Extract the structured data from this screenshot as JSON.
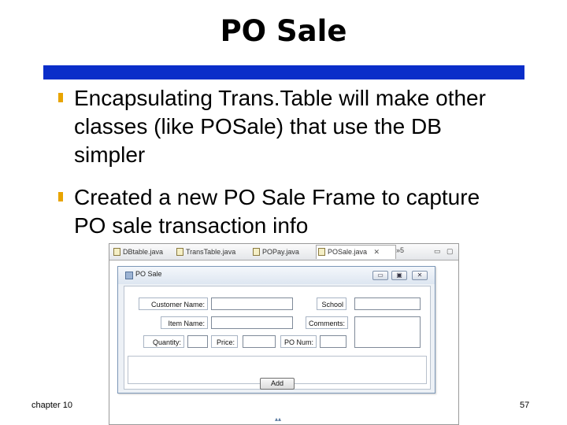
{
  "slide": {
    "title": "PO Sale",
    "bullets": [
      "Encapsulating Trans.Table will make other classes (like POSale) that use the DB simpler",
      "Created a new PO Sale Frame to capture PO sale transaction info"
    ],
    "footer_left": "chapter 10",
    "page_number": "57"
  },
  "editor": {
    "tabs": [
      {
        "label": "DBtable.java",
        "active": false
      },
      {
        "label": "TransTable.java",
        "active": false
      },
      {
        "label": "POPay.java",
        "active": false
      },
      {
        "label": "POSale.java",
        "active": true,
        "close": "✕"
      }
    ],
    "overflow_indicator": "»5",
    "window_controls": {
      "minimize": "▭",
      "maximize": "▢"
    }
  },
  "frame": {
    "title": "PO Sale",
    "controls": {
      "minimize": "▭",
      "maximize": "▣",
      "close": "✕"
    },
    "labels": {
      "customer_name": "Customer Name:",
      "school": "School",
      "item_name": "Item Name:",
      "comments": "Comments:",
      "quantity": "Quantity:",
      "price": "Price:",
      "po_num": "PO Num:"
    },
    "add_button": "Add"
  },
  "colors": {
    "title_rule": "#0a2ec9",
    "bullet_mark": "#e8a400"
  },
  "icons": {
    "bullet": "square-bullet-icon",
    "java_file": "java-file-icon",
    "frame": "window-icon"
  }
}
